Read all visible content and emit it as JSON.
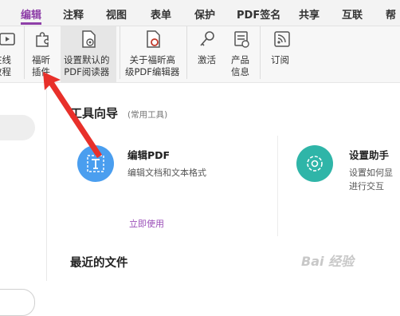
{
  "menu": {
    "tabs": [
      "编辑",
      "注释",
      "视图",
      "表单",
      "保护",
      "PDF签名",
      "共享",
      "互联",
      "帮"
    ],
    "active": 0
  },
  "toolbar": {
    "buttons": [
      {
        "label": "在线\n教程",
        "icon": "video-play-icon"
      },
      {
        "label": "福昕\n插件",
        "icon": "puzzle-plugin-icon"
      },
      {
        "label": "设置默认的\nPDF阅读器",
        "icon": "default-reader-icon"
      },
      {
        "label": "关于福昕高\n级PDF编辑器",
        "icon": "about-editor-icon"
      },
      {
        "label": "激活",
        "icon": "key-icon"
      },
      {
        "label": "产品\n信息",
        "icon": "product-info-icon"
      },
      {
        "label": "订阅",
        "icon": "rss-icon"
      }
    ]
  },
  "main": {
    "section_title": "工具向导",
    "section_sub": "(常用工具)",
    "tools": [
      {
        "title": "编辑PDF",
        "desc": "编辑文档和文本格式",
        "icon": "edit-text-icon",
        "color": "#4a9eef"
      },
      {
        "title": "设置助手",
        "desc": "设置如何显\n进行交互",
        "icon": "setup-gear-icon",
        "color": "#2fb5a8"
      }
    ],
    "use_now": "立即使用",
    "recent_title": "最近的文件"
  },
  "colors": {
    "accent": "#8e3fa8",
    "arrow": "#e8302a"
  },
  "watermark": "Bai 经验"
}
